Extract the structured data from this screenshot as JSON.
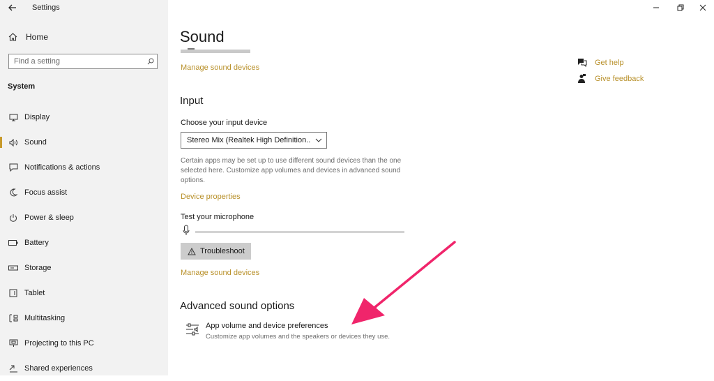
{
  "window": {
    "app_title": "Settings",
    "controls": [
      "minimize",
      "restore",
      "close"
    ]
  },
  "sidebar": {
    "home_label": "Home",
    "search": {
      "placeholder": "Find a setting",
      "value": ""
    },
    "section_label": "System",
    "items": [
      {
        "label": "Display",
        "icon": "monitor-icon"
      },
      {
        "label": "Sound",
        "icon": "speaker-icon",
        "active": true
      },
      {
        "label": "Notifications & actions",
        "icon": "notification-icon"
      },
      {
        "label": "Focus assist",
        "icon": "moon-icon"
      },
      {
        "label": "Power & sleep",
        "icon": "power-icon"
      },
      {
        "label": "Battery",
        "icon": "battery-icon"
      },
      {
        "label": "Storage",
        "icon": "storage-icon"
      },
      {
        "label": "Tablet",
        "icon": "tablet-icon"
      },
      {
        "label": "Multitasking",
        "icon": "multitasking-icon"
      },
      {
        "label": "Projecting to this PC",
        "icon": "projecting-icon"
      },
      {
        "label": "Shared experiences",
        "icon": "shared-icon"
      }
    ]
  },
  "main": {
    "title": "Sound",
    "output_manage_link": "Manage sound devices",
    "input": {
      "heading": "Input",
      "device_label": "Choose your input device",
      "device_value": "Stereo Mix (Realtek High Definition...",
      "description": "Certain apps may be set up to use different sound devices than the one selected here. Customize app volumes and devices in advanced sound options.",
      "device_properties_link": "Device properties",
      "test_label": "Test your microphone",
      "mic_level": 0,
      "troubleshoot_label": "Troubleshoot",
      "manage_link": "Manage sound devices"
    },
    "advanced": {
      "heading": "Advanced sound options",
      "pref_title": "App volume and device preferences",
      "pref_subtitle": "Customize app volumes and the speakers or devices they use."
    }
  },
  "help": {
    "get_help": "Get help",
    "give_feedback": "Give feedback"
  },
  "colors": {
    "accent_link": "#b8902a",
    "selection_bar": "#c79a2b",
    "annotation_arrow": "#f0256b",
    "sidebar_bg": "#f2f2f2"
  }
}
